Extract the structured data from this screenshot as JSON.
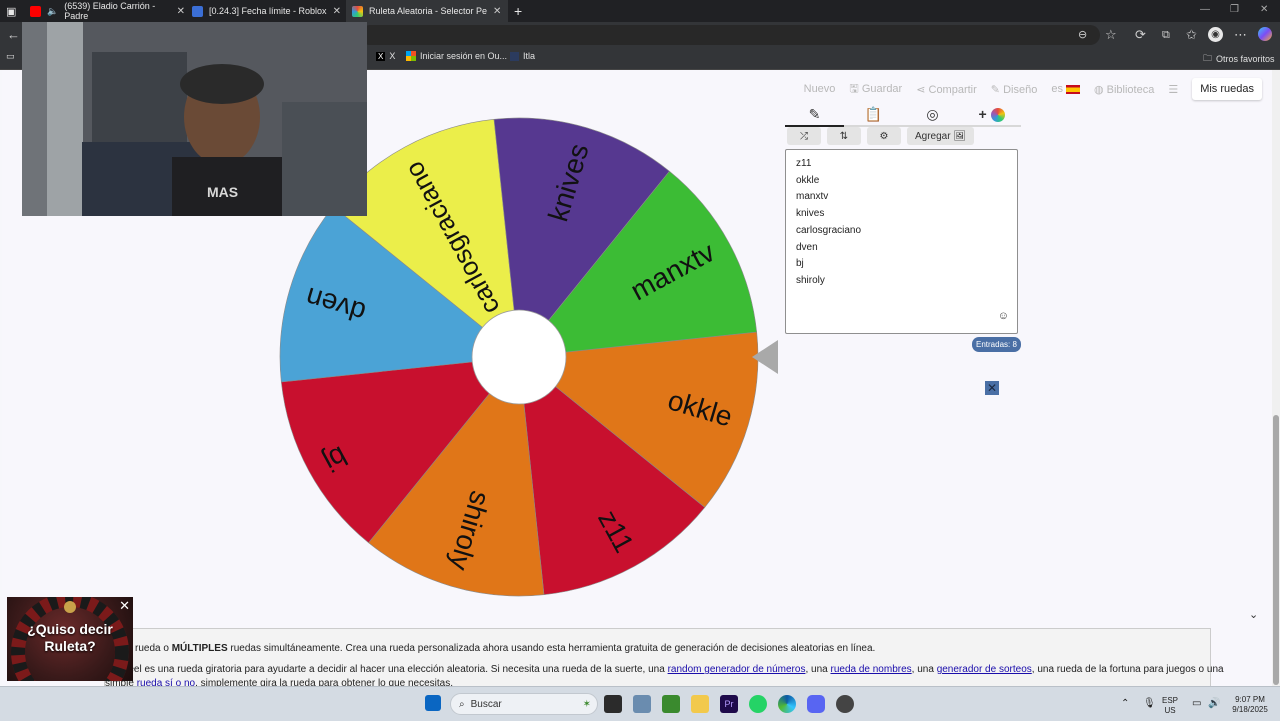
{
  "browser": {
    "tabs": [
      {
        "title": "(6539) Eladio Carrión - Padre",
        "active": false
      },
      {
        "title": "[0.24.3] Fecha límite - Roblox",
        "active": false
      },
      {
        "title": "Ruleta Aleatoria - Selector Person",
        "active": true
      }
    ],
    "new_tab": "+",
    "bookmarks": [
      {
        "label": "X"
      },
      {
        "label": "Iniciar sesión en Ou..."
      },
      {
        "label": "Itla"
      }
    ],
    "other_bookmarks": "Otros favoritos"
  },
  "nav": {
    "nuevo": "Nuevo",
    "guardar": "Guardar",
    "compartir": "Compartir",
    "diseno": "Diseño",
    "lang": "es",
    "biblioteca": "Biblioteca",
    "mis_ruedas": "Mis ruedas"
  },
  "wheel": {
    "segments": [
      {
        "label": "okkle",
        "color": "#e07618"
      },
      {
        "label": "z11",
        "color": "#c8102e"
      },
      {
        "label": "shiroly",
        "color": "#e07618"
      },
      {
        "label": "bj",
        "color": "#c8102e"
      },
      {
        "label": "dven",
        "color": "#4ba3d6"
      },
      {
        "label": "carlosgraciano",
        "color": "#ebee4a"
      },
      {
        "label": "knives",
        "color": "#563890"
      },
      {
        "label": "manxtv",
        "color": "#3cbc35"
      }
    ]
  },
  "editor": {
    "add_label": "Agregar",
    "entries": [
      "z11",
      "okkle",
      "manxtv",
      "knives",
      "carlosgraciano",
      "dven",
      "bj",
      "shiroly"
    ],
    "count_label": "Entradas: 8"
  },
  "description": {
    "line1_pre": "rueda o ",
    "line1_bold": "MÚLTIPLES",
    "line1_post": " ruedas simultáneamente. Crea una rueda personalizada ahora usando esta herramienta gratuita de generación de decisiones aleatorias en línea.",
    "line2_pre": "e Wheel es una rueda giratoria para ayudarte a decidir al hacer una elección aleatoria. Si necesita una rueda de la suerte, una ",
    "link1": "random generador de números",
    "line2_mid1": ", una ",
    "link2": "rueda de nombres",
    "line2_mid2": ", una ",
    "link3": "generador de sorteos",
    "line2_post": ", una rueda de la fortuna para juegos o una",
    "line3_pre": "simple ",
    "link4": "rueda sí o no",
    "line3_post": ", simplemente gira la rueda para obtener lo que necesitas."
  },
  "ad": {
    "text_line1": "¿Quiso decir",
    "text_line2": "Ruleta?"
  },
  "taskbar": {
    "search_placeholder": "Buscar",
    "lang_line1": "ESP",
    "lang_line2": "US",
    "time": "9:07 PM",
    "date": "9/18/2025"
  }
}
